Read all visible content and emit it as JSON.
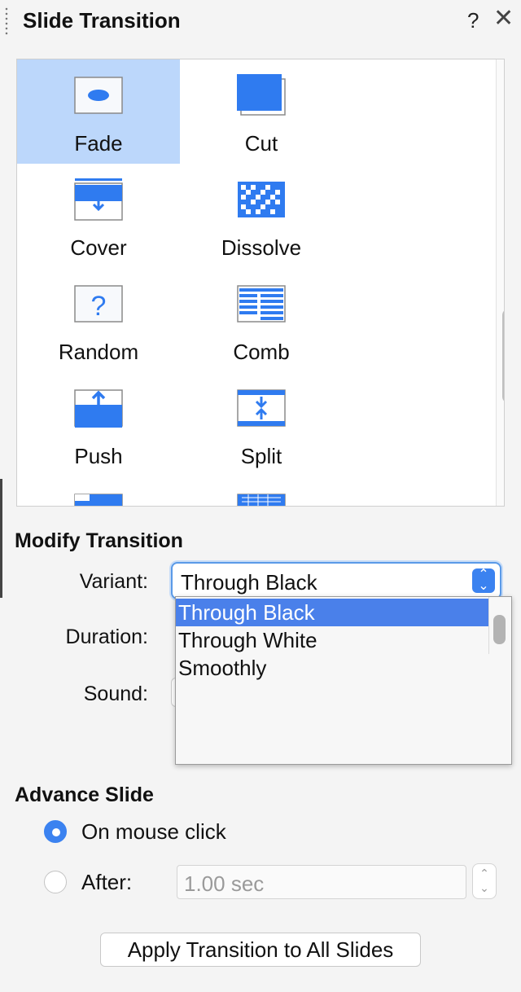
{
  "panel": {
    "title": "Slide Transition",
    "help_label": "?",
    "close_label": "✕"
  },
  "gallery": {
    "items": [
      {
        "label": "Fade",
        "icon": "fade-icon",
        "selected": true
      },
      {
        "label": "Cut",
        "icon": "cut-icon"
      },
      {
        "label": "Cover",
        "icon": "cover-icon"
      },
      {
        "label": "Dissolve",
        "icon": "dissolve-icon"
      },
      {
        "label": "Random",
        "icon": "random-icon"
      },
      {
        "label": "Comb",
        "icon": "comb-icon"
      },
      {
        "label": "Push",
        "icon": "push-icon"
      },
      {
        "label": "Split",
        "icon": "split-icon"
      }
    ]
  },
  "modify": {
    "title": "Modify Transition",
    "variant_label": "Variant:",
    "variant_value": "Through Black",
    "variant_options": [
      "Through Black",
      "Through White",
      "Smoothly"
    ],
    "duration_label": "Duration:",
    "sound_label": "Sound:"
  },
  "advance": {
    "title": "Advance Slide",
    "on_click_label": "On mouse click",
    "on_click_selected": true,
    "after_label": "After:",
    "after_placeholder": "1.00 sec"
  },
  "apply_button": "Apply Transition to All Slides",
  "colors": {
    "accent": "#3b82f0",
    "selection": "#bcd7fb",
    "highlight": "#4a80ea"
  }
}
